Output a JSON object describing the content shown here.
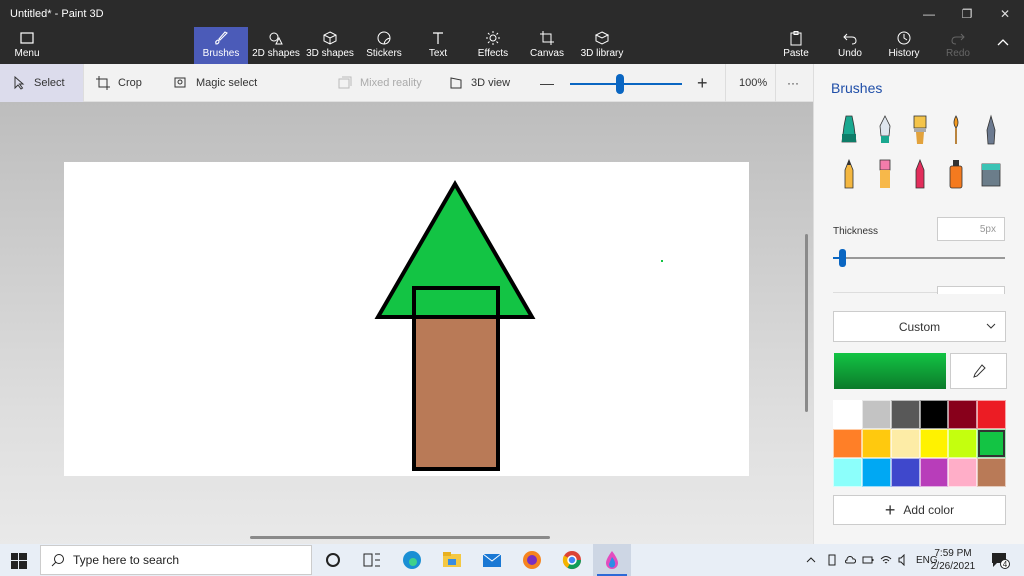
{
  "window": {
    "title": "Untitled* - Paint 3D"
  },
  "ribbon": {
    "menu": "Menu",
    "tools": [
      {
        "label": "Brushes",
        "icon": "brush-icon"
      },
      {
        "label": "2D shapes",
        "icon": "shapes-2d-icon"
      },
      {
        "label": "3D shapes",
        "icon": "cube-icon"
      },
      {
        "label": "Stickers",
        "icon": "sticker-icon"
      },
      {
        "label": "Text",
        "icon": "text-icon"
      },
      {
        "label": "Effects",
        "icon": "sun-icon"
      },
      {
        "label": "Canvas",
        "icon": "canvas-icon"
      },
      {
        "label": "3D library",
        "icon": "library-icon"
      }
    ],
    "paste": "Paste",
    "undo": "Undo",
    "history": "History",
    "redo": "Redo"
  },
  "toolbar": {
    "select": "Select",
    "crop": "Crop",
    "magic_select": "Magic select",
    "mixed_reality": "Mixed reality",
    "view3d": "3D view",
    "zoom": "100%",
    "zoom_level": 0.45,
    "more": "···"
  },
  "panel": {
    "title": "Brushes",
    "thickness_label": "Thickness",
    "thickness_value": "5px",
    "dropdown": "Custom",
    "current_color": "#13c444",
    "add_color": "Add color",
    "palette": [
      "#ffffff",
      "#c3c3c3",
      "#585858",
      "#000000",
      "#88001b",
      "#ec1c24",
      "#ff7f27",
      "#ffc90e",
      "#fdeca6",
      "#fff200",
      "#c4ff0e",
      "#13c444",
      "#8cfffb",
      "#00a8f3",
      "#3f48cc",
      "#b83dba",
      "#ffaec8",
      "#b97a57"
    ],
    "selected_palette_index": 11
  },
  "canvas": {
    "tree_top_color": "#13c444",
    "trunk_color": "#b97a57",
    "outline_color": "#000000"
  },
  "taskbar": {
    "search_placeholder": "Type here to search",
    "lang": "ENG",
    "time": "7:59 PM",
    "date": "2/26/2021",
    "notification_count": "4"
  }
}
